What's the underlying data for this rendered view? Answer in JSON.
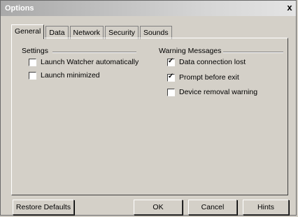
{
  "window": {
    "title": "Options",
    "close_label": "x"
  },
  "tabs": [
    {
      "label": "General",
      "active": true
    },
    {
      "label": "Data",
      "active": false
    },
    {
      "label": "Network",
      "active": false
    },
    {
      "label": "Security",
      "active": false
    },
    {
      "label": "Sounds",
      "active": false
    }
  ],
  "settings": {
    "title": "Settings",
    "items": [
      {
        "label": "Launch Watcher automatically",
        "checked": false
      },
      {
        "label": "Launch minimized",
        "checked": false
      }
    ]
  },
  "warnings": {
    "title": "Warning Messages",
    "items": [
      {
        "label": "Data connection lost",
        "checked": true
      },
      {
        "label": "Prompt before exit",
        "checked": true
      },
      {
        "label": "Device removal warning",
        "checked": false
      }
    ]
  },
  "buttons": {
    "restore": "Restore Defaults",
    "ok": "OK",
    "cancel": "Cancel",
    "hints": "Hints"
  }
}
